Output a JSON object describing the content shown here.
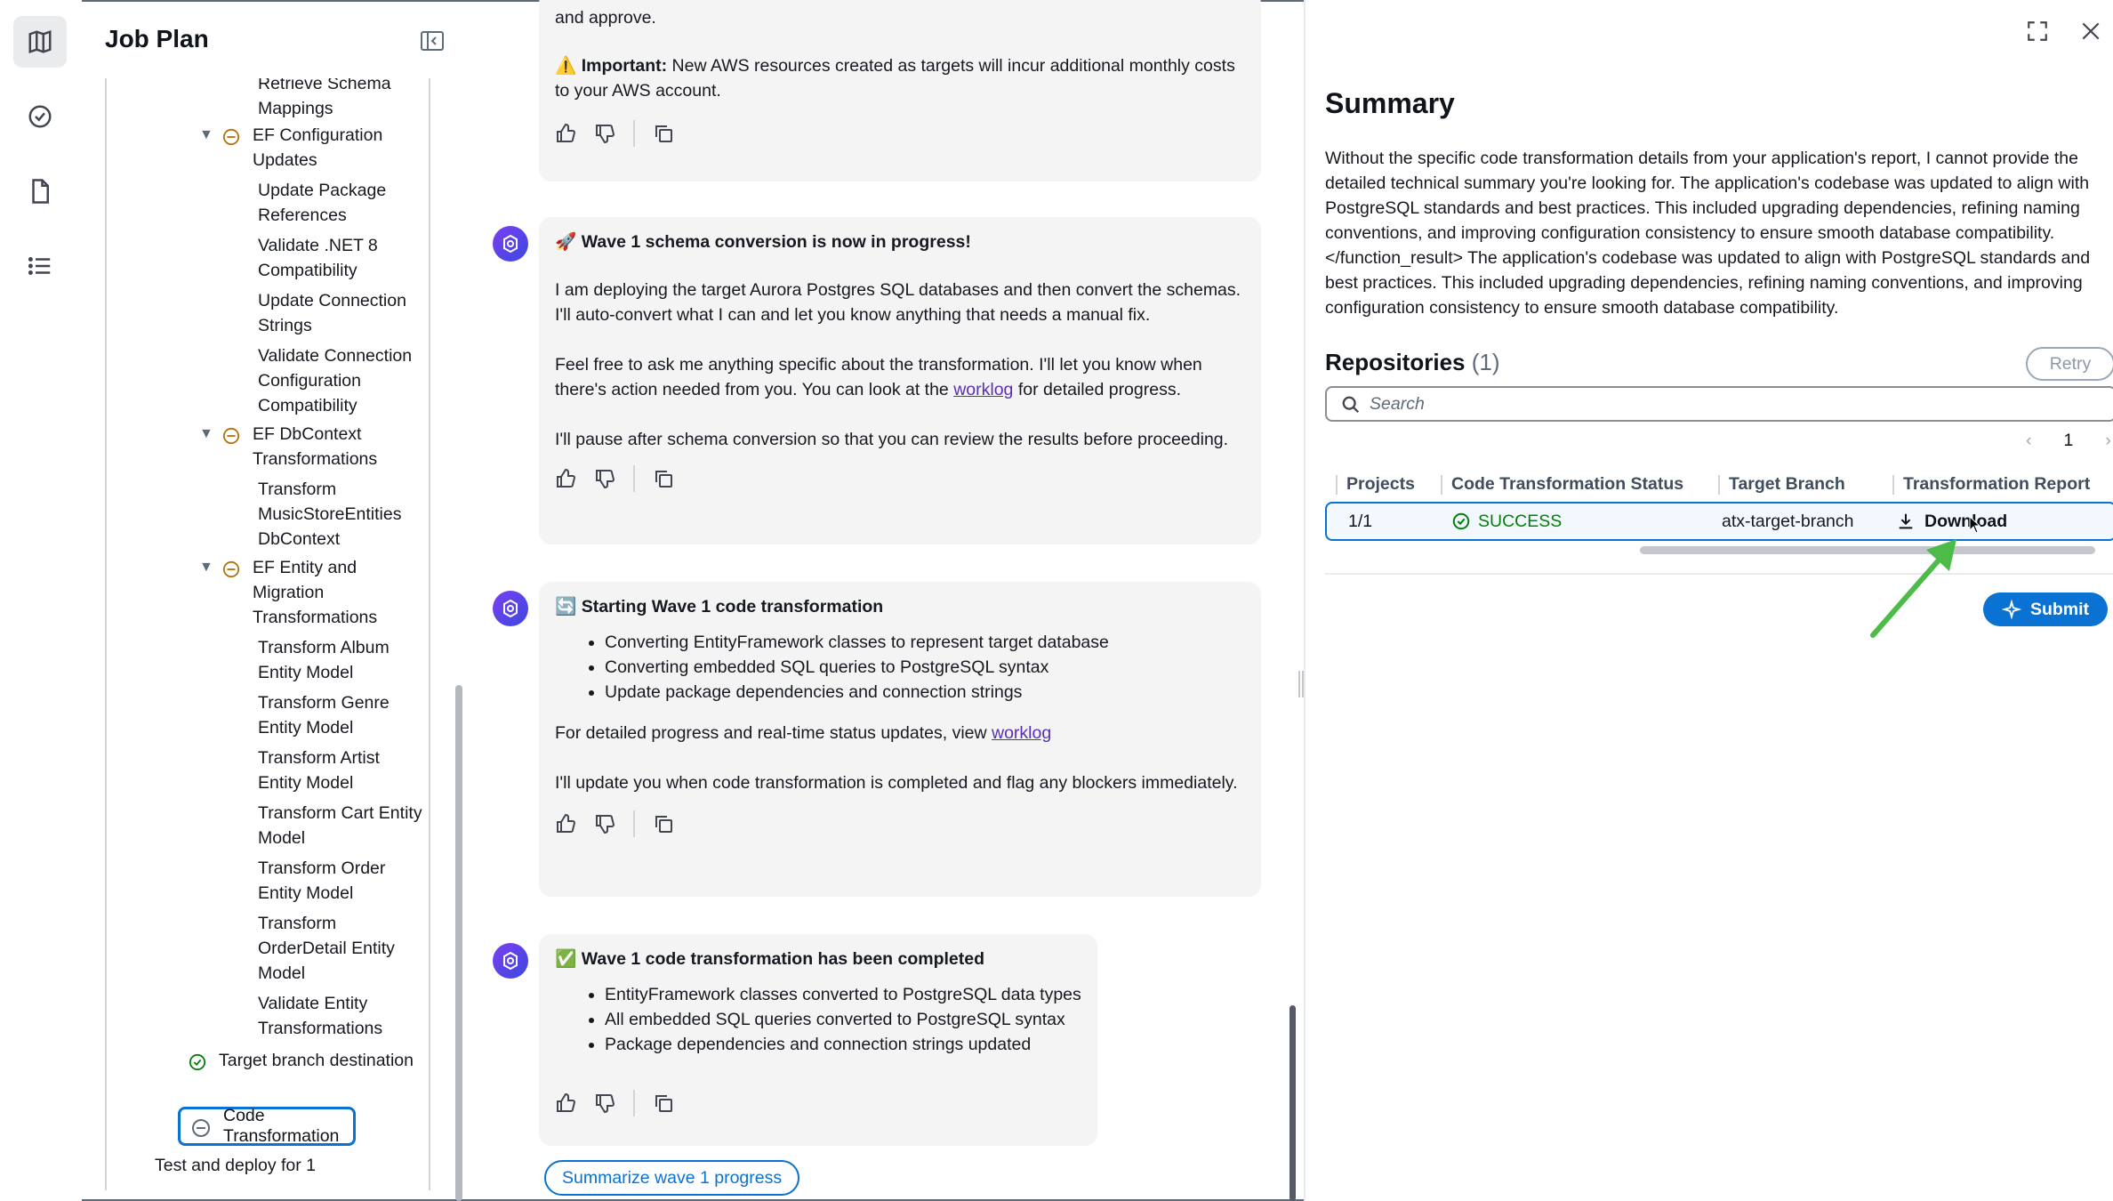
{
  "plan": {
    "title": "Job Plan",
    "items": [
      {
        "text": "Retrieve Schema Mappings",
        "kind": "leaf"
      },
      {
        "text": "EF Configuration Updates",
        "kind": "group"
      },
      {
        "text": "Update Package References",
        "kind": "leaf"
      },
      {
        "text": "Validate .NET 8 Compatibility",
        "kind": "leaf"
      },
      {
        "text": "Update Connection Strings",
        "kind": "leaf"
      },
      {
        "text": "Validate Connection Configuration Compatibility",
        "kind": "leaf"
      },
      {
        "text": "EF DbContext Transformations",
        "kind": "group"
      },
      {
        "text": "Transform MusicStoreEntities DbContext",
        "kind": "leaf"
      },
      {
        "text": "EF Entity and Migration Transformations",
        "kind": "group"
      },
      {
        "text": "Transform Album Entity Model",
        "kind": "leaf"
      },
      {
        "text": "Transform Genre Entity Model",
        "kind": "leaf"
      },
      {
        "text": "Transform Artist Entity Model",
        "kind": "leaf"
      },
      {
        "text": "Transform Cart Entity Model",
        "kind": "leaf"
      },
      {
        "text": "Transform Order Entity Model",
        "kind": "leaf"
      },
      {
        "text": "Transform OrderDetail Entity Model",
        "kind": "leaf"
      },
      {
        "text": "Validate Entity Transformations",
        "kind": "leaf"
      },
      {
        "text": "Target branch destination",
        "kind": "done"
      },
      {
        "text": "Code Transformation",
        "kind": "current"
      },
      {
        "text": "Test and deploy for 1",
        "kind": "plain"
      }
    ]
  },
  "chat": {
    "msg0": {
      "line1": "and approve.",
      "important_label": "Important:",
      "important_text": " New AWS resources created as targets will incur additional monthly costs to your AWS account."
    },
    "msg1": {
      "head": "Wave 1 schema conversion is now in progress!",
      "p1": "I am deploying the target Aurora Postgres SQL databases and then convert the schemas. I'll auto-convert what I can and let you know anything that needs a manual fix.",
      "p2a": "Feel free to ask me anything specific about the transformation. I'll let you know when there's action needed from you. You can look at the ",
      "link": "worklog",
      "p2b": " for detailed progress.",
      "p3": "I'll pause after schema conversion so that you can review the results before proceeding."
    },
    "msg2": {
      "head": "Starting Wave 1 code transformation",
      "bullets": [
        "Converting EntityFramework classes to represent target database",
        "Converting embedded SQL queries to PostgreSQL syntax",
        "Update package dependencies and connection strings"
      ],
      "p1a": "For detailed progress and real-time status updates, view ",
      "link": "worklog",
      "p2": "I'll update you when code transformation is completed and flag any blockers immediately."
    },
    "msg3": {
      "head": "Wave 1 code transformation has been completed",
      "bullets": [
        "EntityFramework classes converted to PostgreSQL data types",
        "All embedded SQL queries converted to PostgreSQL syntax",
        "Package dependencies and connection strings updated"
      ]
    },
    "chip": "Summarize wave 1 progress"
  },
  "summary": {
    "title": "Summary",
    "body": "Without the specific code transformation details from your application's report, I cannot provide the detailed technical summary you're looking for. The application's codebase was updated to align with PostgreSQL standards and best practices. This included upgrading dependencies, refining naming conventions, and improving configuration consistency to ensure smooth database compatibility. </function_result> The application's codebase was updated to align with PostgreSQL standards and best practices. This included upgrading dependencies, refining naming conventions, and improving configuration consistency to ensure smooth database compatibility.",
    "repo_title": "Repositories",
    "repo_count": "(1)",
    "retry": "Retry",
    "search_placeholder": "Search",
    "page": "1",
    "columns": [
      "Projects",
      "Code Transformation Status",
      "Target Branch",
      "Transformation Report"
    ],
    "row": {
      "project": "1/1",
      "status": "SUCCESS",
      "branch": "atx-target-branch",
      "report": "Download"
    },
    "submit": "Submit"
  },
  "colors": {
    "accent": "#0972d3",
    "success": "#037f0c",
    "in_progress": "#b5720a",
    "annotation_arrow": "#4cbb47"
  }
}
